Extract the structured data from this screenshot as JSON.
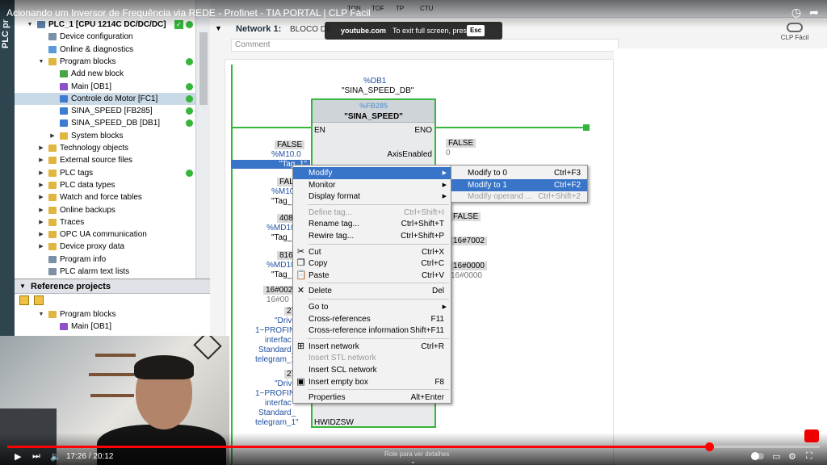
{
  "video": {
    "title": "Acionando um Inversor de Frequência via REDE - Profinet - TIA PORTAL | CLP Fácil",
    "channel": "CLP Fácil",
    "fullscreen_toast": {
      "domain": "youtube.com",
      "text": "To exit full screen, press",
      "key": "Esc"
    },
    "time": "17:26 / 20:12",
    "progress": 0.864,
    "scroll_hint": "Role para ver detalhes",
    "scroll_hint_arrow": "⌄"
  },
  "left_strip": {
    "label": "PLC pr"
  },
  "project_tree": [
    {
      "label": "PLC_1 [CPU 1214C DC/DC/DC]",
      "indent": 0,
      "arrow": "▼",
      "icon": "#5b7fa6",
      "dot": true,
      "check": true,
      "bold": true
    },
    {
      "label": "Device configuration",
      "indent": 1,
      "arrow": "",
      "icon": "#7b8fa6",
      "dot": false
    },
    {
      "label": "Online & diagnostics",
      "indent": 1,
      "arrow": "",
      "icon": "#5a9ad6",
      "dot": false
    },
    {
      "label": "Program blocks",
      "indent": 1,
      "arrow": "▼",
      "icon": "#e0b640",
      "dot": true
    },
    {
      "label": "Add new block",
      "indent": 2,
      "arrow": "",
      "icon": "#46a646",
      "dot": false
    },
    {
      "label": "Main [OB1]",
      "indent": 2,
      "arrow": "",
      "icon": "#8e4fc9",
      "dot": true
    },
    {
      "label": "Controle do Motor [FC1]",
      "indent": 2,
      "arrow": "",
      "icon": "#3f7bd0",
      "dot": true,
      "selected": true
    },
    {
      "label": "SINA_SPEED [FB285]",
      "indent": 2,
      "arrow": "",
      "icon": "#3f7bd0",
      "dot": true
    },
    {
      "label": "SINA_SPEED_DB [DB1]",
      "indent": 2,
      "arrow": "",
      "icon": "#3f7bd0",
      "dot": true
    },
    {
      "label": "System blocks",
      "indent": 2,
      "arrow": "▶",
      "icon": "#e0b640",
      "dot": false
    },
    {
      "label": "Technology objects",
      "indent": 1,
      "arrow": "▶",
      "icon": "#e0b640",
      "dot": false
    },
    {
      "label": "External source files",
      "indent": 1,
      "arrow": "▶",
      "icon": "#e0b640",
      "dot": false
    },
    {
      "label": "PLC tags",
      "indent": 1,
      "arrow": "▶",
      "icon": "#e0b640",
      "dot": true
    },
    {
      "label": "PLC data types",
      "indent": 1,
      "arrow": "▶",
      "icon": "#e0b640",
      "dot": false
    },
    {
      "label": "Watch and force tables",
      "indent": 1,
      "arrow": "▶",
      "icon": "#e0b640",
      "dot": false
    },
    {
      "label": "Online backups",
      "indent": 1,
      "arrow": "▶",
      "icon": "#e0b640",
      "dot": false
    },
    {
      "label": "Traces",
      "indent": 1,
      "arrow": "▶",
      "icon": "#e0b640",
      "dot": false
    },
    {
      "label": "OPC UA communication",
      "indent": 1,
      "arrow": "▶",
      "icon": "#e0b640",
      "dot": false
    },
    {
      "label": "Device proxy data",
      "indent": 1,
      "arrow": "▶",
      "icon": "#e0b640",
      "dot": false
    },
    {
      "label": "Program info",
      "indent": 1,
      "arrow": "",
      "icon": "#7b8fa6",
      "dot": false
    },
    {
      "label": "PLC alarm text lists",
      "indent": 1,
      "arrow": "",
      "icon": "#7b8fa6",
      "dot": false
    }
  ],
  "reference_projects": {
    "title": "Reference projects",
    "items": [
      {
        "label": "Program blocks",
        "indent": 1,
        "arrow": "▼",
        "icon": "#e0b640"
      },
      {
        "label": "Main [OB1]",
        "indent": 2,
        "arrow": "",
        "icon": "#8e4fc9"
      }
    ]
  },
  "toolbar": {
    "items": [
      "TON",
      "TOF",
      "TP",
      "CTU"
    ]
  },
  "network": {
    "title": "Network 1:",
    "name": "BLOCO DE",
    "comment": "Comment"
  },
  "fb": {
    "db_addr": "%DB1",
    "db_name": "\"SINA_SPEED_DB\"",
    "fb_addr": "%FB285",
    "fb_name": "\"SINA_SPEED\"",
    "pins": {
      "en": "EN",
      "eno": "ENO",
      "axis_enabled": "AxisEnabled",
      "hwid": "HWIDZSW"
    }
  },
  "tags": {
    "t1_val": "FALSE",
    "t1_addr": "%M10.0",
    "t1_name": "\"Tag_1\"",
    "t2_val": "FALS",
    "t2_addr": "%M10",
    "t2_name": "\"Tag_",
    "t3_val": "408",
    "t3_addr": "%MD10",
    "t3_name": "\"Tag_",
    "t4_val": "816",
    "t4_addr": "%MD10",
    "t4_name": "\"Tag_",
    "t5_val": "16#002",
    "t5_sub": "16#00",
    "t6_val": "27",
    "t6_l1": "\"Drive",
    "t6_l2": "1~PROFINE",
    "t6_l3": "interfac",
    "t6_l4": "Standard_",
    "t6_l5": "telegram_1",
    "t7_val": "27",
    "t7_l1": "\"Drive",
    "t7_l2": "1~PROFINE",
    "t7_l3": "interfac",
    "t7_l4": "Standard_",
    "t7_l5": "telegram_1\"",
    "out_false1": "FALSE",
    "out_zero1": "0",
    "out_false2": "FALSE",
    "out_hex1": "16#7002",
    "out_hex2": "16#0000",
    "out_hex3": "16#0000"
  },
  "context_menu": [
    {
      "label": "Modify",
      "shortcut": "",
      "submenu": true,
      "highlight": true
    },
    {
      "label": "Monitor",
      "shortcut": "",
      "submenu": true
    },
    {
      "label": "Display format",
      "shortcut": "",
      "submenu": true
    },
    {
      "sep": true
    },
    {
      "label": "Define tag...",
      "shortcut": "Ctrl+Shift+I",
      "disabled": true
    },
    {
      "label": "Rename tag...",
      "shortcut": "Ctrl+Shift+T"
    },
    {
      "label": "Rewire tag...",
      "shortcut": "Ctrl+Shift+P"
    },
    {
      "sep": true
    },
    {
      "label": "Cut",
      "shortcut": "Ctrl+X",
      "icon": "✂",
      "iconName": "scissors-icon"
    },
    {
      "label": "Copy",
      "shortcut": "Ctrl+C",
      "icon": "❐",
      "iconName": "copy-icon"
    },
    {
      "label": "Paste",
      "shortcut": "Ctrl+V",
      "icon": "📋",
      "iconName": "clipboard-icon"
    },
    {
      "sep": true
    },
    {
      "label": "Delete",
      "shortcut": "Del",
      "icon": "✕",
      "iconName": "delete-x-icon"
    },
    {
      "sep": true
    },
    {
      "label": "Go to",
      "shortcut": "",
      "submenu": true
    },
    {
      "label": "Cross-references",
      "shortcut": "F11"
    },
    {
      "label": "Cross-reference information",
      "shortcut": "Shift+F11"
    },
    {
      "sep": true
    },
    {
      "label": "Insert network",
      "shortcut": "Ctrl+R",
      "icon": "⊞",
      "iconName": "insert-network-icon"
    },
    {
      "label": "Insert STL network",
      "shortcut": "",
      "disabled": true
    },
    {
      "label": "Insert SCL network",
      "shortcut": ""
    },
    {
      "label": "Insert empty box",
      "shortcut": "F8",
      "icon": "▣",
      "iconName": "empty-box-icon"
    },
    {
      "sep": true
    },
    {
      "label": "Properties",
      "shortcut": "Alt+Enter"
    }
  ],
  "submenu": [
    {
      "label": "Modify to 0",
      "shortcut": "Ctrl+F3"
    },
    {
      "label": "Modify to 1",
      "shortcut": "Ctrl+F2",
      "highlight": true
    },
    {
      "label": "Modify operand ...",
      "shortcut": "Ctrl+Shift+2",
      "disabled": true
    }
  ],
  "colors": {
    "accent": "#3874c8",
    "ladder_green": "#35b53a",
    "progress_red": "#ff0000"
  }
}
